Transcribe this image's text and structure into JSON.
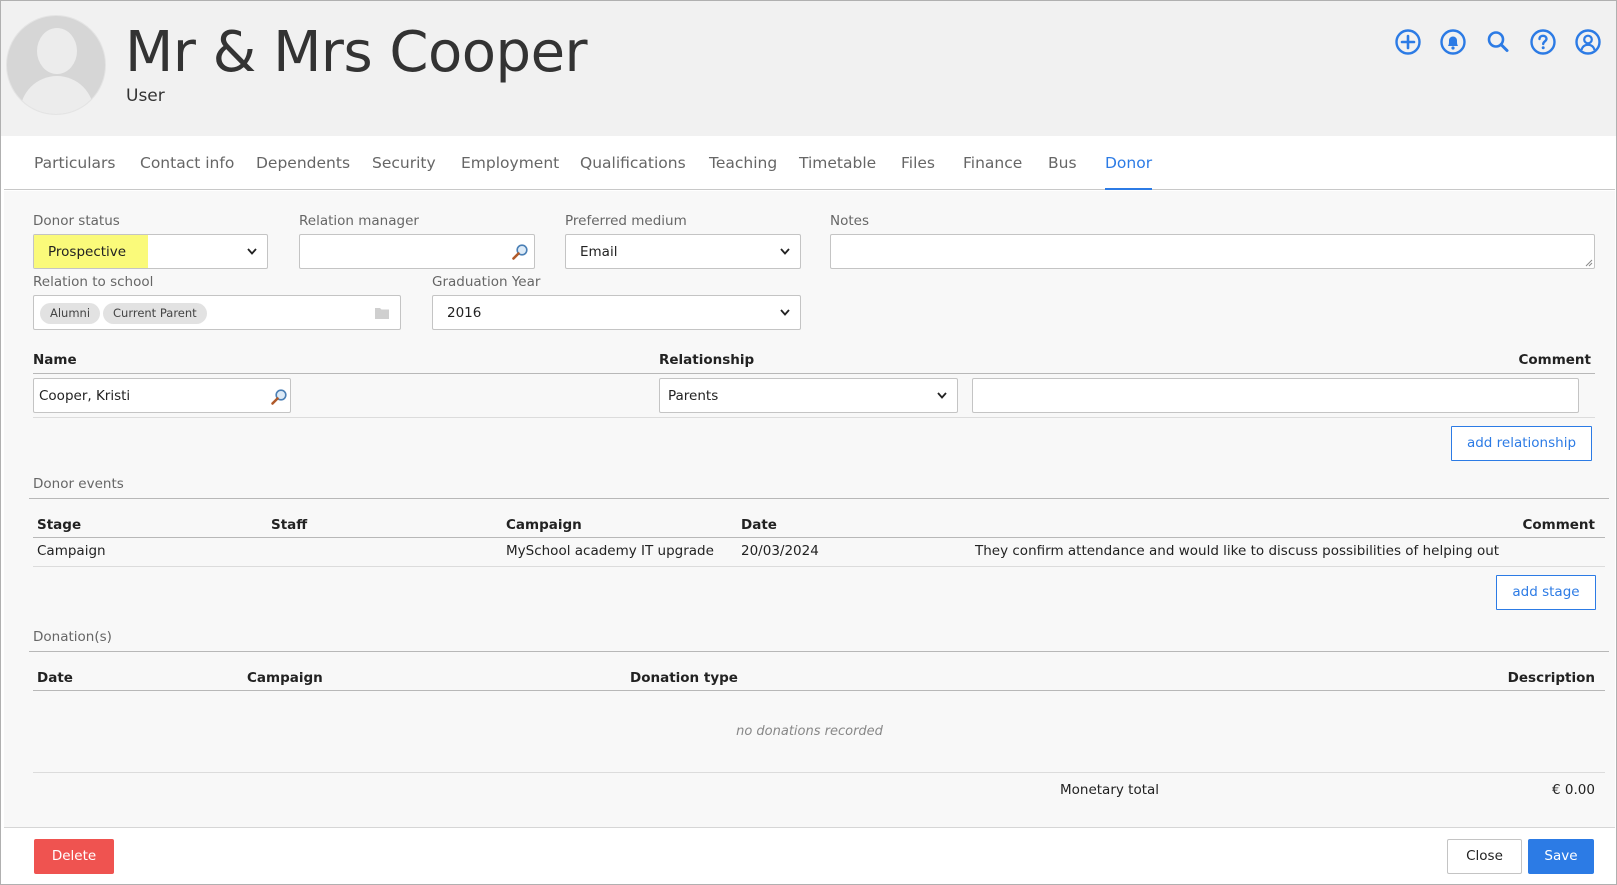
{
  "header": {
    "title": "Mr & Mrs Cooper",
    "subtitle": "User"
  },
  "top_icons": [
    "plus-circle-icon",
    "bell-icon",
    "search-icon",
    "help-icon",
    "user-account-icon"
  ],
  "colors": {
    "accent": "#2c7be5",
    "danger": "#ef5350",
    "highlight": "#fafa7a"
  },
  "tabs": [
    {
      "label": "Particulars"
    },
    {
      "label": "Contact info"
    },
    {
      "label": "Dependents"
    },
    {
      "label": "Security"
    },
    {
      "label": "Employment"
    },
    {
      "label": "Qualifications"
    },
    {
      "label": "Teaching"
    },
    {
      "label": "Timetable"
    },
    {
      "label": "Files"
    },
    {
      "label": "Finance"
    },
    {
      "label": "Bus"
    },
    {
      "label": "Donor",
      "active": true
    }
  ],
  "form": {
    "donor_status_label": "Donor status",
    "donor_status_value": "Prospective",
    "relation_manager_label": "Relation manager",
    "relation_manager_value": "",
    "preferred_medium_label": "Preferred medium",
    "preferred_medium_value": "Email",
    "notes_label": "Notes",
    "notes_value": "",
    "relation_to_school_label": "Relation to school",
    "relation_tags": [
      "Alumni",
      "Current Parent"
    ],
    "graduation_year_label": "Graduation Year",
    "graduation_year_value": "2016"
  },
  "relationships": {
    "columns": {
      "name": "Name",
      "relationship": "Relationship",
      "comment": "Comment"
    },
    "row": {
      "name": "Cooper, Kristi",
      "relationship": "Parents",
      "comment": ""
    },
    "add_button": "add relationship"
  },
  "donor_events": {
    "section_title": "Donor events",
    "columns": {
      "stage": "Stage",
      "staff": "Staff",
      "campaign": "Campaign",
      "date": "Date",
      "comment": "Comment"
    },
    "rows": [
      {
        "stage": "Campaign",
        "staff": "",
        "campaign": "MySchool academy IT upgrade",
        "date": "20/03/2024",
        "comment": "They confirm attendance and would like to discuss possibilities of helping out"
      }
    ],
    "add_button": "add stage"
  },
  "donations": {
    "section_title": "Donation(s)",
    "columns": {
      "date": "Date",
      "campaign": "Campaign",
      "type": "Donation type",
      "description": "Description"
    },
    "empty_message": "no donations recorded",
    "total_label": "Monetary total",
    "total_value": "€ 0.00"
  },
  "footer": {
    "delete_label": "Delete",
    "close_label": "Close",
    "save_label": "Save"
  }
}
